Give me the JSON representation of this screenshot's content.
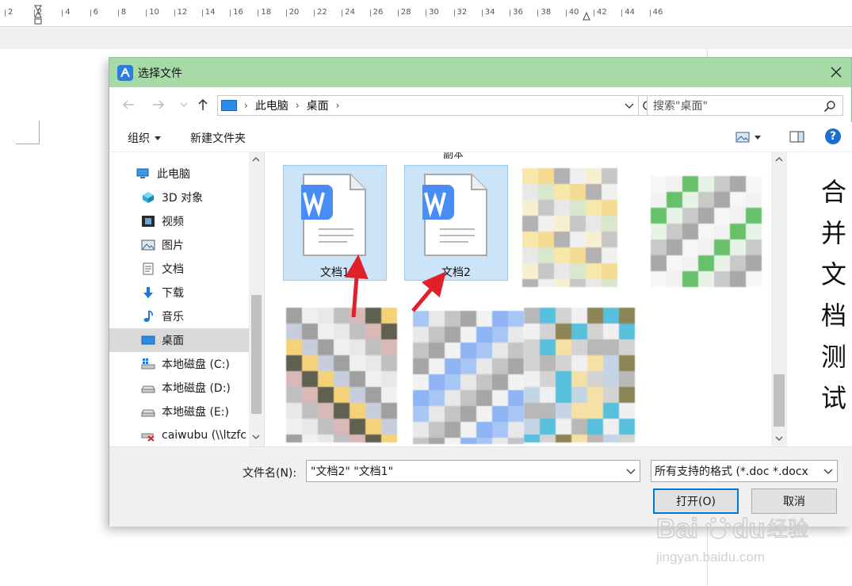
{
  "ruler": {
    "ticks": [
      "2",
      "2",
      "4",
      "6",
      "8",
      "10",
      "12",
      "14",
      "16",
      "18",
      "20",
      "22",
      "24",
      "26",
      "28",
      "30",
      "32",
      "34",
      "36",
      "38",
      "40",
      "42",
      "44",
      "46"
    ]
  },
  "dialog": {
    "title": "选择文件",
    "close_icon": "close-icon",
    "nav": {
      "back_icon": "arrow-left-icon",
      "forward_icon": "arrow-right-icon",
      "recent_icon": "chevron-down-icon",
      "up_icon": "arrow-up-icon",
      "breadcrumbs": [
        "此电脑",
        "桌面"
      ],
      "refresh_icon": "refresh-icon",
      "search_placeholder": "搜索\"桌面\""
    },
    "toolbar": {
      "organize": "组织",
      "new_folder": "新建文件夹",
      "help": "?"
    },
    "sidebar": {
      "items": [
        {
          "label": "此电脑",
          "icon": "computer-icon",
          "selected": false
        },
        {
          "label": "3D 对象",
          "icon": "cube-3d-icon",
          "selected": false
        },
        {
          "label": "视频",
          "icon": "film-icon",
          "selected": false
        },
        {
          "label": "图片",
          "icon": "picture-icon",
          "selected": false
        },
        {
          "label": "文档",
          "icon": "document-icon",
          "selected": false
        },
        {
          "label": "下载",
          "icon": "download-arrow-icon",
          "selected": false
        },
        {
          "label": "音乐",
          "icon": "music-note-icon",
          "selected": false
        },
        {
          "label": "桌面",
          "icon": "desktop-icon",
          "selected": true
        },
        {
          "label": "本地磁盘 (C:)",
          "icon": "windows-drive-icon",
          "selected": false
        },
        {
          "label": "本地磁盘 (D:)",
          "icon": "drive-icon",
          "selected": false
        },
        {
          "label": "本地磁盘 (E:)",
          "icon": "drive-icon",
          "selected": false
        },
        {
          "label": "caiwubu (\\\\ltzfc",
          "icon": "network-drive-disconnected-icon",
          "selected": false
        }
      ]
    },
    "files": {
      "caption_top": "副本",
      "items": [
        {
          "name": "文档1",
          "icon": "wps-word-doc-icon",
          "selected": true
        },
        {
          "name": "文档2",
          "icon": "wps-word-doc-icon",
          "selected": true
        }
      ]
    },
    "preview": {
      "chars": [
        "合",
        "并",
        "文",
        "档",
        "测",
        "试"
      ]
    },
    "bottom": {
      "filename_label": "文件名(N):",
      "filename_value": "\"文档2\" \"文档1\"",
      "filetype_value": "所有支持的格式 (*.doc *.docx",
      "open_label": "打开(O)",
      "cancel_label": "取消"
    }
  },
  "watermark": {
    "logo_text": "Bai",
    "logo_text2": "du",
    "logo_cn": "经验",
    "url": "jingyan.baidu.com"
  },
  "colors": {
    "titlebar": "#a6dba8",
    "selection": "#cce4f7",
    "accent": "#0078d7",
    "wps_blue": "#4a8cf5",
    "arrow_red": "#e0202a"
  }
}
